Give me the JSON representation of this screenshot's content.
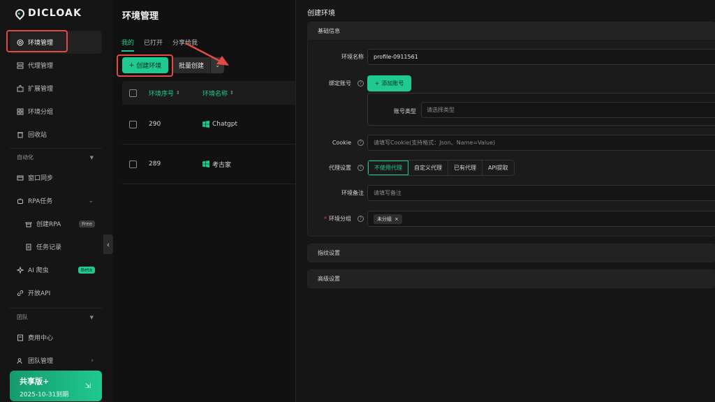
{
  "brand": {
    "name": "DICLOAK"
  },
  "sidebar": {
    "items": [
      {
        "label": "环境管理"
      },
      {
        "label": "代理管理"
      },
      {
        "label": "扩展管理"
      },
      {
        "label": "环境分组"
      },
      {
        "label": "回收站"
      }
    ],
    "automation_label": "自动化",
    "automation_items": [
      {
        "label": "窗口同步"
      },
      {
        "label": "RPA任务"
      },
      {
        "label": "创建RPA",
        "badge": "Free"
      },
      {
        "label": "任务记录"
      },
      {
        "label": "AI 爬虫",
        "badge": "Beta"
      },
      {
        "label": "开放API"
      }
    ],
    "team_label": "团队",
    "team_items": [
      {
        "label": "费用中心"
      },
      {
        "label": "团队管理"
      }
    ],
    "plan": {
      "name": "共享版+",
      "expiry": "2025-10-31到期"
    }
  },
  "main": {
    "title": "环境管理",
    "tabs": [
      {
        "label": "我的"
      },
      {
        "label": "已打开"
      },
      {
        "label": "分享给我"
      }
    ],
    "create_button": "创建环境",
    "batch_button": "批量创建",
    "columns": {
      "id": "环境序号",
      "name": "环境名称"
    },
    "rows": [
      {
        "id": "290",
        "name": "Chatgpt"
      },
      {
        "id": "289",
        "name": "考古家"
      }
    ]
  },
  "panel": {
    "title": "创建环境",
    "basic_section": "基础信息",
    "fields": {
      "name_label": "环境名称",
      "name_value": "profile-0911561",
      "account_label": "绑定账号",
      "add_account_button": "添加账号",
      "account_type_label": "账号类型",
      "account_type_placeholder": "请选择类型",
      "cookie_label": "Cookie",
      "cookie_placeholder": "请填写Cookie(支持格式：Json、Name=Value)",
      "proxy_label": "代理设置",
      "proxy_options": [
        "不使用代理",
        "自定义代理",
        "已有代理",
        "API提取"
      ],
      "note_label": "环境备注",
      "note_placeholder": "请填写备注",
      "group_label": "环境分组",
      "group_tag": "未分组"
    },
    "fingerprint_section": "指纹设置",
    "advanced_section": "高级设置"
  },
  "colors": {
    "accent": "#1fc98f",
    "highlight": "#e24a45",
    "bg": "#141414"
  }
}
